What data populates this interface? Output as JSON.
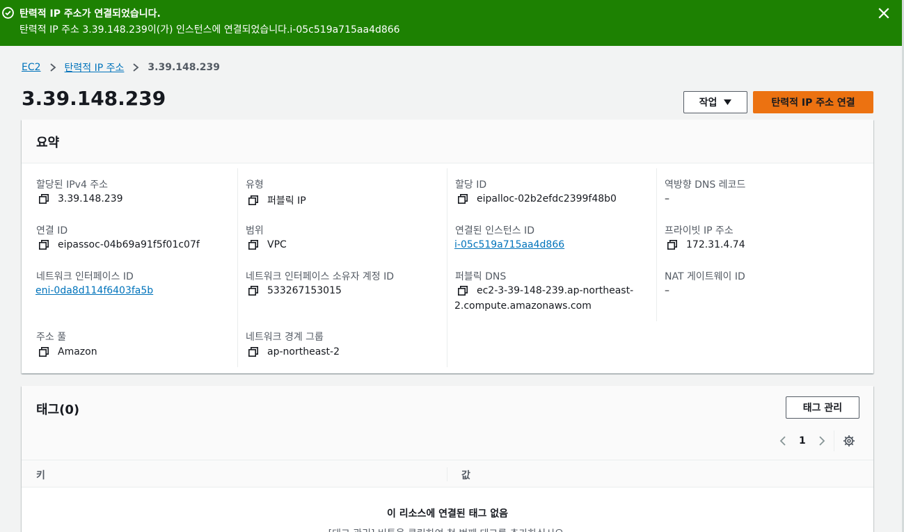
{
  "flash": {
    "title": "탄력적 IP 주소가 연결되었습니다.",
    "message": "탄력적 IP 주소 3.39.148.239이(가) 인스턴스에 연결되었습니다.i-05c519a715aa4d866",
    "icons": {
      "status": "check-circle-icon",
      "close": "close-icon"
    },
    "color": "#1d8102"
  },
  "breadcrumb": {
    "items": [
      "EC2",
      "탄력적 IP 주소"
    ],
    "current": "3.39.148.239"
  },
  "page": {
    "title": "3.39.148.239",
    "actions_label": "작업",
    "primary_label": "탄력적 IP 주소 연결",
    "primary_color": "#ec7211"
  },
  "summary": {
    "title": "요약",
    "fields": {
      "allocated_ipv4": {
        "label": "할당된 IPv4 주소",
        "value": "3.39.148.239"
      },
      "type": {
        "label": "유형",
        "value": "퍼블릭 IP"
      },
      "allocation_id": {
        "label": "할당 ID",
        "value": "eipalloc-02b2efdc2399f48b0"
      },
      "reverse_dns": {
        "label": "역방향 DNS 레코드",
        "value": "–"
      },
      "association_id": {
        "label": "연결 ID",
        "value": "eipassoc-04b69a91f5f01c07f"
      },
      "scope": {
        "label": "범위",
        "value": "VPC"
      },
      "instance_id": {
        "label": "연결된 인스턴스 ID",
        "value": "i-05c519a715aa4d866"
      },
      "private_ip": {
        "label": "프라이빗 IP 주소",
        "value": "172.31.4.74"
      },
      "eni_id": {
        "label": "네트워크 인터페이스 ID",
        "value": "eni-0da8d114f6403fa5b"
      },
      "eni_owner": {
        "label": "네트워크 인터페이스 소유자 계정 ID",
        "value": "533267153015"
      },
      "public_dns": {
        "label": "퍼블릭 DNS",
        "value_line1": "ec2-3-39-148-239.ap-northeast-",
        "value_line2": "2.compute.amazonaws.com"
      },
      "nat_gateway": {
        "label": "NAT 게이트웨이 ID",
        "value": "–"
      },
      "address_pool": {
        "label": "주소 풀",
        "value": "Amazon"
      },
      "network_border": {
        "label": "네트워크 경계 그룹",
        "value": "ap-northeast-2"
      }
    }
  },
  "tags": {
    "title": "태그(0)",
    "manage_label": "태그 관리",
    "page_number": "1",
    "columns": [
      "키",
      "값"
    ],
    "empty_title": "이 리소스에 연결된 태그 없음",
    "empty_subtitle": "[태그 관리] 버튼을 클릭하여 첫 번째 태그를 추가하십시오."
  }
}
